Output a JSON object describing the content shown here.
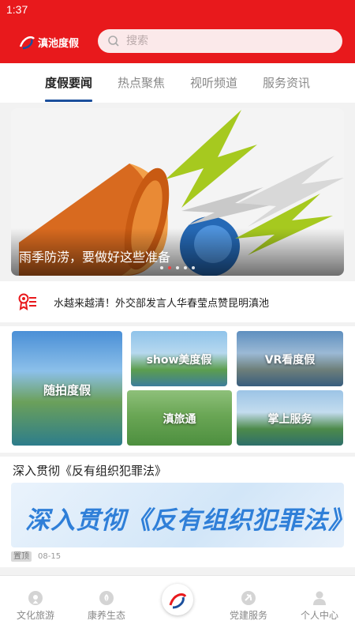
{
  "status_bar": {
    "time": "1:37"
  },
  "header": {
    "logo_text": "滇池度假",
    "search": {
      "placeholder": "搜索",
      "value": ""
    }
  },
  "tabs": [
    {
      "label": "度假要闻",
      "active": true
    },
    {
      "label": "热点聚焦",
      "active": false
    },
    {
      "label": "视听频道",
      "active": false
    },
    {
      "label": "服务资讯",
      "active": false
    }
  ],
  "banner": {
    "caption": "雨季防涝，要做好这些准备",
    "slide_count": 6,
    "active_slide": 2
  },
  "news_ticker": {
    "icon": "award-list-icon",
    "text": "水越来越清！外交部发言人华春莹点赞昆明滇池"
  },
  "feature_tiles": [
    {
      "label": "随拍度假"
    },
    {
      "label": "show美度假"
    },
    {
      "label": "VR看度假"
    },
    {
      "label": "滇旅通"
    },
    {
      "label": "掌上服务"
    }
  ],
  "article": {
    "title": "深入贯彻《反有组织犯罪法》",
    "image_text": "深入贯彻《反有组织犯罪法》",
    "pin_label": "置顶",
    "date": "08-15"
  },
  "bottom_nav": [
    {
      "label": "文化旅游",
      "icon": "culture-icon"
    },
    {
      "label": "康养生态",
      "icon": "leaf-icon"
    },
    {
      "label": "",
      "icon": "app-logo-icon"
    },
    {
      "label": "党建服务",
      "icon": "party-emblem-icon"
    },
    {
      "label": "个人中心",
      "icon": "person-icon"
    }
  ],
  "colors": {
    "brand_red": "#e8191c",
    "accent_blue": "#1b4f9c"
  }
}
